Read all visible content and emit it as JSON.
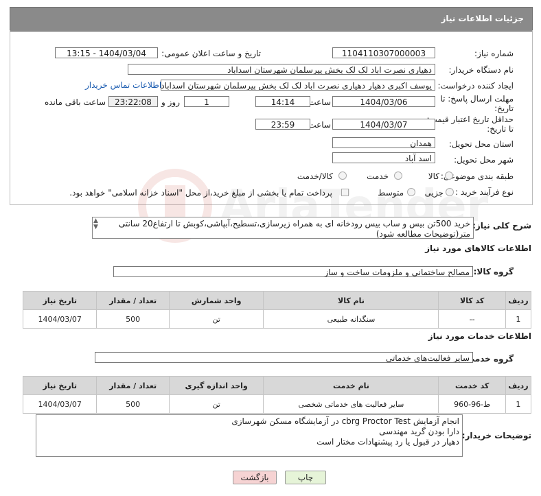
{
  "header": {
    "title": "جزئیات اطلاعات نیاز"
  },
  "form": {
    "need_number_label": "شماره نیاز:",
    "need_number": "1104110307000003",
    "announce_label": "تاریخ و ساعت اعلان عمومی:",
    "announce_value": "1404/03/04 - 13:15",
    "buyer_org_label": "نام دستگاه خریدار:",
    "buyer_org": "دهیاری نصرت اباد لک لک بخش پیرسلمان شهرستان اسداباد",
    "creator_label": "ایجاد کننده درخواست:",
    "creator": "یوسف اکبری دهیار دهیاری نصرت اباد لک لک بخش پیرسلمان شهرستان اسداباد",
    "contact_link": "اطلاعات تماس خریدار",
    "deadline_label_1": "مهلت ارسال پاسخ: تا",
    "deadline_label_2": "تاریخ:",
    "deadline_date": "1404/03/06",
    "time_label": "ساعت",
    "deadline_time": "14:14",
    "days_value": "1",
    "days_label": "روز و",
    "remaining_time": "23:22:08",
    "remaining_label": "ساعت باقی مانده",
    "min_validity_label_1": "حداقل تاریخ اعتبار قیمت:",
    "min_validity_label_2": "تا تاریخ:",
    "validity_date": "1404/03/07",
    "validity_time": "23:59",
    "province_label": "استان محل تحویل:",
    "province": "همدان",
    "city_label": "شهر محل تحویل:",
    "city": "اسد آباد",
    "category_label": "طبقه بندی موضوعی:",
    "category_options": [
      "کالا",
      "خدمت",
      "کالا/خدمت"
    ],
    "purchase_type_label": "نوع فرآیند خرید :",
    "purchase_options": [
      "جزیی",
      "متوسط"
    ],
    "payment_note": "پرداخت تمام یا بخشی از مبلغ خرید،از محل \"اسناد خزانه اسلامی\" خواهد بود."
  },
  "description": {
    "label": "شرح کلی نیاز:",
    "text": "خرید 500تن بیس و ساب بیس رودخانه ای به همراه زیرسازی،تسطیح،آبپاشی،کوبش تا ارتفاع20 سانتی متر(توضیحات مطالعه شود)"
  },
  "goods": {
    "section_title": "اطلاعات کالاهای مورد نیاز",
    "group_label": "گروه کالا:",
    "group_value": "مصالح ساختمانی و ملزومات ساخت و ساز",
    "columns": [
      "ردیف",
      "کد کالا",
      "نام کالا",
      "واحد شمارش",
      "تعداد / مقدار",
      "تاریخ نیاز"
    ],
    "rows": [
      [
        "1",
        "--",
        "سنگدانه طبیعی",
        "تن",
        "500",
        "1404/03/07"
      ]
    ]
  },
  "services": {
    "section_title": "اطلاعات خدمات مورد نیاز",
    "group_label": "گروه خدمت:",
    "group_value": "سایر فعالیت‌های خدماتی",
    "columns": [
      "ردیف",
      "کد خدمت",
      "نام خدمت",
      "واحد اندازه گیری",
      "تعداد / مقدار",
      "تاریخ نیاز"
    ],
    "rows": [
      [
        "1",
        "ط-96-960",
        "سایر فعالیت های خدماتی شخصی",
        "تن",
        "500",
        "1404/03/07"
      ]
    ]
  },
  "notes": {
    "label": "توضیحات خریدار:",
    "lines": [
      "انجام آزمایش cbrg Proctor Test در آزمایشگاه مسکن شهرسازی",
      "دارا بودن گرید مهندسی",
      "دهیار در قبول یا رد پیشنهادات مختار است"
    ]
  },
  "buttons": {
    "print": "چاپ",
    "back": "بازگشت"
  },
  "colors": {
    "header_bg": "#8a8a8a",
    "link": "#1a5bb0",
    "back_btn": "#f6d3d3",
    "print_btn": "#e6f4d8"
  }
}
